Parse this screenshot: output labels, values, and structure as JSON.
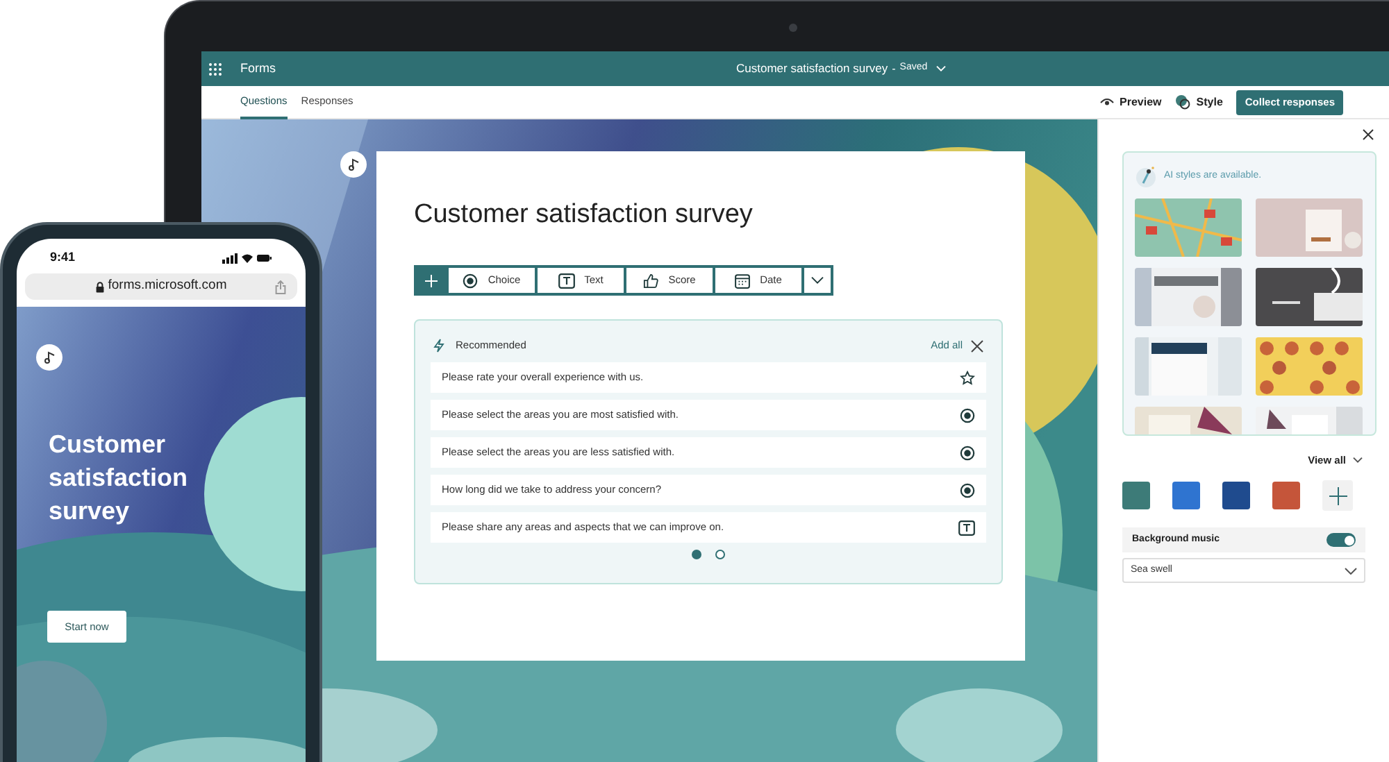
{
  "laptop": {
    "app_bar": {
      "app_name": "Forms",
      "title": "Customer satisfaction survey",
      "separator": "-",
      "status": "Saved"
    },
    "tabs": [
      {
        "label": "Questions",
        "selected": true
      },
      {
        "label": "Responses",
        "selected": false
      }
    ],
    "actions": {
      "preview": "Preview",
      "style": "Style",
      "collect": "Collect responses"
    },
    "form": {
      "title": "Customer satisfaction survey",
      "add_types": [
        {
          "kind": "choice",
          "label": "Choice"
        },
        {
          "kind": "text",
          "label": "Text"
        },
        {
          "kind": "score",
          "label": "Score"
        },
        {
          "kind": "date",
          "label": "Date"
        }
      ],
      "recommended": {
        "heading": "Recommended",
        "add_all": "Add all",
        "questions": [
          {
            "text": "Please rate your overall experience with us.",
            "kind": "rating"
          },
          {
            "text": "Please select the areas you are most satisfied with.",
            "kind": "choice"
          },
          {
            "text": "Please select the areas you are less satisfied with.",
            "kind": "choice"
          },
          {
            "text": "How long did we take to address your concern?",
            "kind": "choice"
          },
          {
            "text": "Please share any areas and aspects that we can improve on.",
            "kind": "text"
          }
        ],
        "pages": [
          {
            "selected": true
          },
          {
            "selected": false
          }
        ]
      }
    },
    "style_panel": {
      "ai_note": "AI styles are available.",
      "view_all": "View all",
      "colors": [
        {
          "color": "#3d7b78"
        },
        {
          "color": "#2f74d0"
        },
        {
          "color": "#1f4b8e"
        },
        {
          "color": "#c5553a"
        }
      ],
      "background_music": {
        "label": "Background music",
        "on": true
      },
      "music_select": {
        "value": "Sea swell"
      }
    }
  },
  "phone": {
    "time": "9:41",
    "url": "forms.microsoft.com",
    "title": "Customer satisfaction survey",
    "start_button": "Start now"
  }
}
